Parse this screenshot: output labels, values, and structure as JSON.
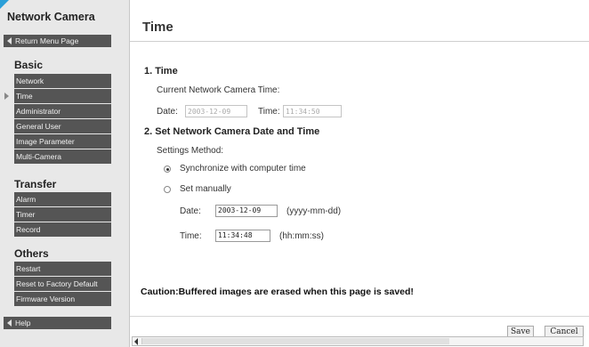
{
  "sidebar": {
    "brand": "Network Camera",
    "return_label": "Return Menu Page",
    "help_label": "Help",
    "sections": {
      "basic": {
        "title": "Basic",
        "items": [
          "Network",
          "Time",
          "Administrator",
          "General User",
          "Image Parameter",
          "Multi-Camera"
        ]
      },
      "transfer": {
        "title": "Transfer",
        "items": [
          "Alarm",
          "Timer",
          "Record"
        ]
      },
      "others": {
        "title": "Others",
        "items": [
          "Restart",
          "Reset to Factory Default",
          "Firmware Version"
        ]
      }
    },
    "active_item": "Time"
  },
  "main": {
    "title": "Time",
    "section1": {
      "heading": "1. Time",
      "subheading": "Current Network Camera Time:",
      "date_label": "Date:",
      "date_value": "2003-12-09",
      "time_label": "Time:",
      "time_value": "11:34:50"
    },
    "section2": {
      "heading": "2. Set Network Camera Date and Time",
      "method_label": "Settings Method:",
      "option_sync": "Synchronize with computer time",
      "option_manual": "Set manually",
      "selected_option": "sync",
      "date_label": "Date:",
      "date_value": "2003-12-09",
      "date_format": "(yyyy-mm-dd)",
      "time_label": "Time:",
      "time_value": "11:34:48",
      "time_format": "(hh:mm:ss)"
    },
    "caution": "Caution:Buffered images are erased when this page is saved!",
    "save_label": "Save",
    "cancel_label": "Cancel"
  },
  "colors": {
    "menu_bg": "#555555",
    "sidebar_bg": "#e8e8e8",
    "corner_accent": "#2a9fd8"
  }
}
